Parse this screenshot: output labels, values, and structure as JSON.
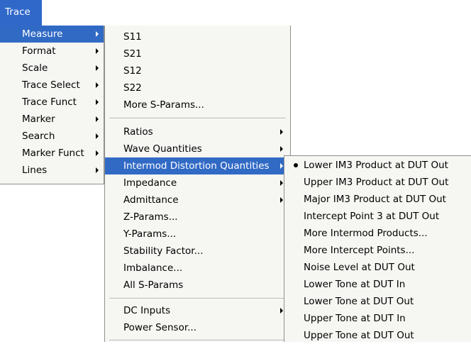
{
  "menubar": {
    "trace_label": "Trace"
  },
  "main_menu": {
    "items": [
      {
        "label": "Measure"
      },
      {
        "label": "Format"
      },
      {
        "label": "Scale"
      },
      {
        "label": "Trace Select"
      },
      {
        "label": "Trace Funct"
      },
      {
        "label": "Marker"
      },
      {
        "label": "Search"
      },
      {
        "label": "Marker Funct"
      },
      {
        "label": "Lines"
      }
    ]
  },
  "measure_menu": {
    "group1": [
      {
        "label": "S11"
      },
      {
        "label": "S21"
      },
      {
        "label": "S12"
      },
      {
        "label": "S22"
      },
      {
        "label": "More S-Params..."
      }
    ],
    "group2": [
      {
        "label": "Ratios"
      },
      {
        "label": "Wave Quantities"
      },
      {
        "label": "Intermod Distortion Quantities"
      },
      {
        "label": "Impedance"
      },
      {
        "label": "Admittance"
      },
      {
        "label": "Z-Params..."
      },
      {
        "label": "Y-Params..."
      },
      {
        "label": "Stability Factor..."
      },
      {
        "label": "Imbalance..."
      },
      {
        "label": "All S-Params"
      }
    ],
    "group3": [
      {
        "label": "DC Inputs"
      },
      {
        "label": "Power Sensor..."
      }
    ]
  },
  "intermod_menu": {
    "items": [
      {
        "label": "Lower IM3 Product at DUT Out",
        "checked": true
      },
      {
        "label": "Upper IM3 Product at DUT Out"
      },
      {
        "label": "Major IM3 Product at DUT Out"
      },
      {
        "label": "Intercept Point 3 at DUT Out"
      },
      {
        "label": "More Intermod Products..."
      },
      {
        "label": "More Intercept Points..."
      },
      {
        "label": "Noise Level at DUT Out"
      },
      {
        "label": "Lower Tone at DUT In"
      },
      {
        "label": "Lower Tone at DUT Out"
      },
      {
        "label": "Upper Tone at DUT In"
      },
      {
        "label": "Upper Tone at DUT Out"
      }
    ]
  },
  "colors": {
    "highlight": "#316ac5",
    "menu_bg": "#f6f6f3",
    "border": "#8f8f8f"
  }
}
